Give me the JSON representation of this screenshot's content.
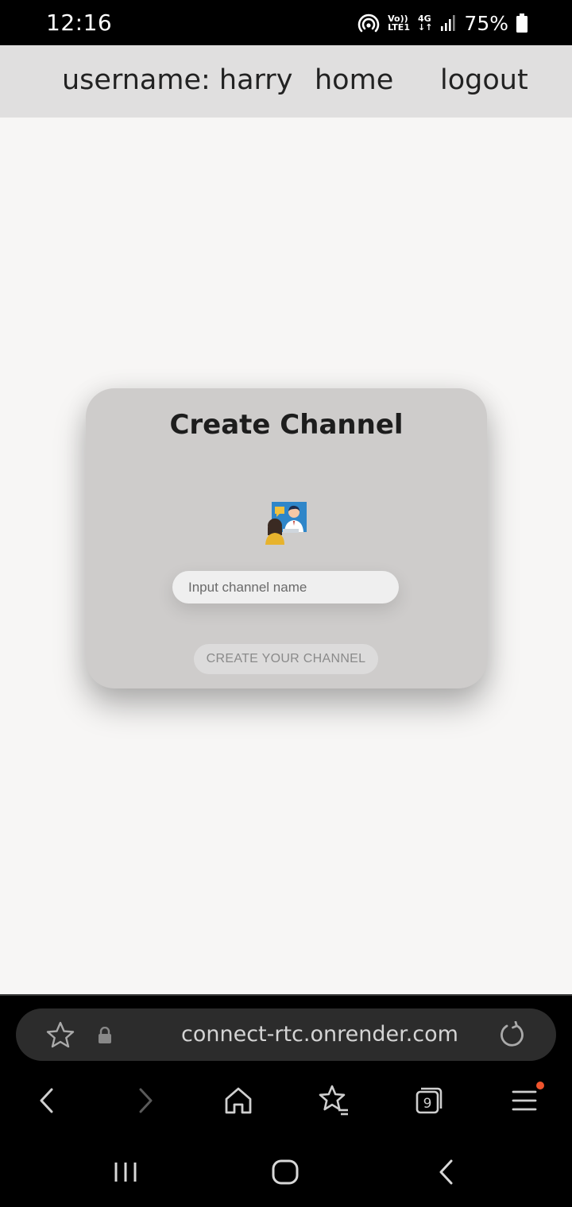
{
  "status_bar": {
    "time": "12:16",
    "network_top": "Vo))",
    "network_bottom": "LTE1",
    "network_type": "4G",
    "battery": "75%",
    "icons": [
      "hotspot-icon",
      "signal-icon",
      "battery-icon"
    ]
  },
  "nav": {
    "username": "username: harry",
    "home": "home",
    "logout": "logout"
  },
  "card": {
    "title": "Create Channel",
    "input_placeholder": "Input channel name",
    "input_value": "",
    "button": "CREATE YOUR CHANNEL",
    "illustration": "video-call-illustration-icon"
  },
  "browser": {
    "url": "connect-rtc.onrender.com",
    "tab_count": "9",
    "icons": [
      "bookmark-star-icon",
      "lock-icon",
      "reload-icon",
      "back-icon",
      "forward-icon",
      "home-icon",
      "bookmarks-icon",
      "tabs-icon",
      "menu-icon"
    ]
  },
  "android_nav": {
    "icons": [
      "recent-apps-icon",
      "home-icon",
      "back-icon"
    ]
  },
  "colors": {
    "page_bg": "#f7f6f5",
    "navbar_bg": "#e0dfdf",
    "card_bg": "#cecccb",
    "menu_badge": "#f0542d"
  }
}
